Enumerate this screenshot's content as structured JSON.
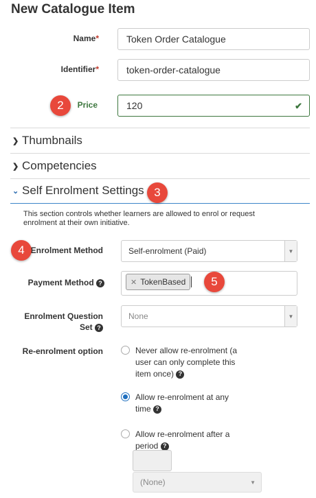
{
  "page_title": "New Catalogue Item",
  "fields": {
    "name": {
      "label": "Name",
      "required_mark": "*",
      "value": "Token Order Catalogue"
    },
    "identifier": {
      "label": "Identifier",
      "required_mark": "*",
      "value": "token-order-catalogue"
    },
    "price": {
      "label": "Price",
      "value": "120"
    }
  },
  "sections": {
    "thumbnails": "Thumbnails",
    "competencies": "Competencies",
    "self_enrolment": "Self Enrolment Settings"
  },
  "self_enrolment": {
    "description": "This section controls whether learners are allowed to enrol or request enrolment at their own initiative.",
    "enrolment_method": {
      "label": "Enrolment Method",
      "value": "Self-enrolment (Paid)"
    },
    "payment_method": {
      "label": "Payment Method",
      "tag": "TokenBased"
    },
    "question_set": {
      "label_line1": "Enrolment Question",
      "label_line2": "Set",
      "value": "None"
    },
    "reenrolment": {
      "label": "Re-enrolment option",
      "options": [
        {
          "line1": "Never allow re-enrolment (a",
          "line2": "user can only complete this",
          "line3": "item once)",
          "selected": false
        },
        {
          "line1": "Allow re-enrolment at any",
          "line2": "time",
          "selected": true
        },
        {
          "line1": "Allow re-enrolment after a",
          "line2": "period",
          "selected": false
        }
      ],
      "period_unit": "(None)"
    }
  },
  "callouts": [
    "2",
    "3",
    "4",
    "5"
  ],
  "colors": {
    "accent_blue": "#2b6cb0",
    "valid_green": "#3c763d",
    "callout_red": "#e8483b",
    "required_red": "#c0392b"
  },
  "icons": [
    "check-icon",
    "chevron-right-icon",
    "chevron-down-icon",
    "help-icon",
    "remove-tag-icon",
    "dropdown-arrow-icon"
  ]
}
